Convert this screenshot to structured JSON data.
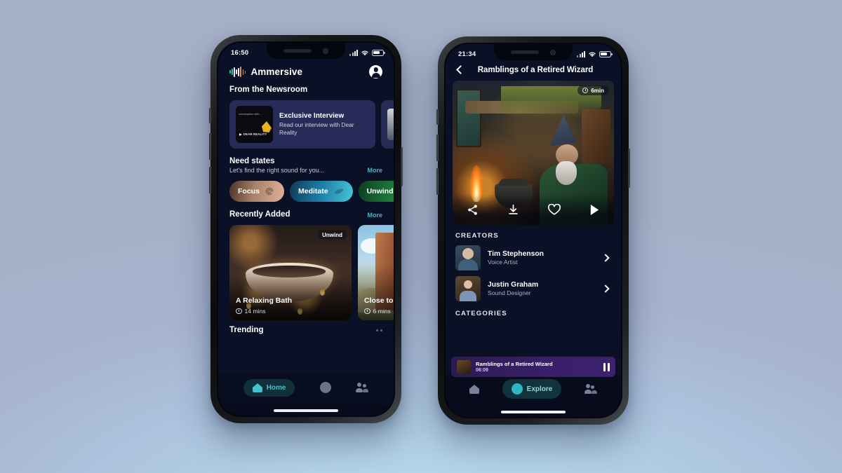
{
  "background": {
    "gradient_from": "#a6b0c8",
    "gradient_to": "#b7dcef"
  },
  "theme": {
    "app_bg": "#0a1026",
    "accent_teal": "#3fb8c8",
    "news_card_bg": "#262c57",
    "miniplayer_purple": "#3a1f6b"
  },
  "phone_home": {
    "status_bar": {
      "time": "16:50",
      "signal_icon": "cellular-bars-icon",
      "wifi_icon": "wifi-icon",
      "battery_icon": "battery-icon"
    },
    "header": {
      "brand": "Ammersive",
      "logo_icon": "waveform-icon",
      "account_icon": "account-avatar-icon"
    },
    "newsroom": {
      "title": "From the Newsroom",
      "cards": [
        {
          "title": "Exclusive Interview",
          "description": "Read our interview with Dear Reality",
          "thumb_caption": "conversation with...",
          "thumb_brand": "DEAR REALITY"
        }
      ]
    },
    "need_states": {
      "title": "Need states",
      "subtitle": "Let's find the right sound for you...",
      "more_label": "More",
      "pills": [
        {
          "label": "Focus",
          "icon": "focus-spiral-icon",
          "color": "#e0b295"
        },
        {
          "label": "Meditate",
          "icon": "meditate-leaf-icon",
          "color": "#49c4d8"
        },
        {
          "label": "Unwind",
          "icon": "unwind-icon",
          "color": "#2ea34c"
        }
      ]
    },
    "recently_added": {
      "title": "Recently Added",
      "more_label": "More",
      "cards": [
        {
          "title": "A Relaxing Bath",
          "duration": "14 mins",
          "tag": "Unwind",
          "art": "bathroom-candles"
        },
        {
          "title": "Close to",
          "duration": "6 mins",
          "tag": "",
          "art": "castle-tower"
        }
      ]
    },
    "trending": {
      "title": "Trending",
      "menu_icon": "overflow-dots-icon"
    },
    "tabbar": [
      {
        "label": "Home",
        "icon": "home-icon",
        "active": true
      },
      {
        "label": "",
        "icon": "compass-icon",
        "active": false
      },
      {
        "label": "",
        "icon": "people-icon",
        "active": false
      }
    ]
  },
  "phone_detail": {
    "status_bar": {
      "time": "21:34",
      "signal_icon": "cellular-bars-icon",
      "wifi_icon": "wifi-icon",
      "battery_icon": "battery-icon"
    },
    "header": {
      "back_icon": "chevron-left-icon",
      "title": "Ramblings of a Retired Wizard"
    },
    "hero": {
      "duration_badge": "6min",
      "duration_icon": "clock-icon",
      "art": "wizard-cauldron-cottage",
      "actions": [
        {
          "name": "share-icon",
          "label": "Share"
        },
        {
          "name": "download-icon",
          "label": "Download"
        },
        {
          "name": "heart-icon",
          "label": "Favourite"
        },
        {
          "name": "play-icon",
          "label": "Play"
        }
      ]
    },
    "creators": {
      "section_label": "CREATORS",
      "items": [
        {
          "name": "Tim Stephenson",
          "role": "Voice Artist",
          "chevron_icon": "chevron-right-icon"
        },
        {
          "name": "Justin Graham",
          "role": "Sound Designer",
          "chevron_icon": "chevron-right-icon"
        }
      ]
    },
    "categories": {
      "section_label": "CATEGORIES"
    },
    "miniplayer": {
      "title": "Ramblings of a Retired Wizard",
      "time": "06:09",
      "pause_icon": "pause-icon"
    },
    "tabbar": [
      {
        "label": "",
        "icon": "home-icon",
        "active": false
      },
      {
        "label": "Explore",
        "icon": "compass-icon",
        "active": true
      },
      {
        "label": "",
        "icon": "people-icon",
        "active": false
      }
    ]
  }
}
